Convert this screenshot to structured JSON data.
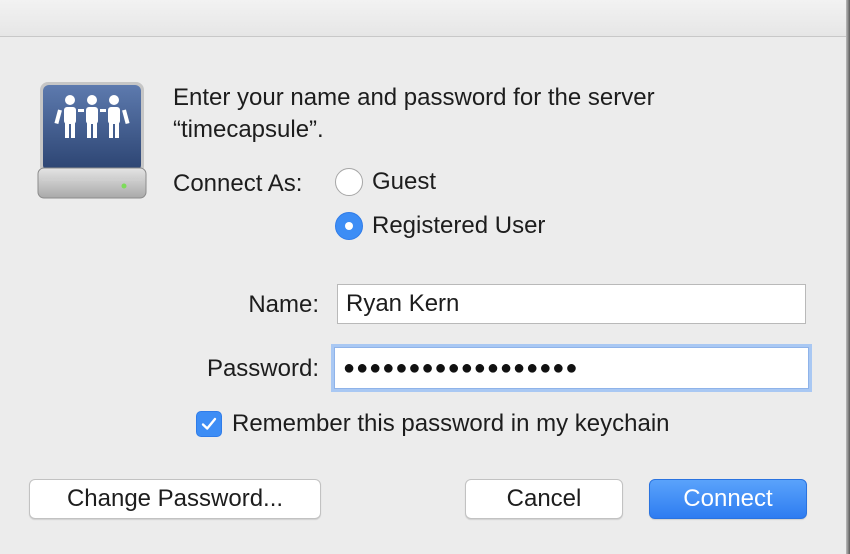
{
  "dialog": {
    "message_line1": "Enter your name and password for the server",
    "message_line2": "“timecapsule”.",
    "connect_as_label": "Connect As:",
    "options": [
      {
        "label": "Guest",
        "selected": false
      },
      {
        "label": "Registered User",
        "selected": true
      }
    ],
    "name_label": "Name:",
    "name_value": "Ryan Kern",
    "password_label": "Password:",
    "password_masked": "●●●●●●●●●●●●●●●●●●",
    "remember_label": "Remember this password in my keychain",
    "remember_checked": true
  },
  "buttons": {
    "change_password": "Change Password...",
    "cancel": "Cancel",
    "connect": "Connect"
  },
  "colors": {
    "accent": "#3d8df5",
    "background": "#ececec",
    "icon_blue": "#3d5a8a"
  },
  "icons": {
    "server": "network-server-icon",
    "check": "checkmark-icon"
  }
}
